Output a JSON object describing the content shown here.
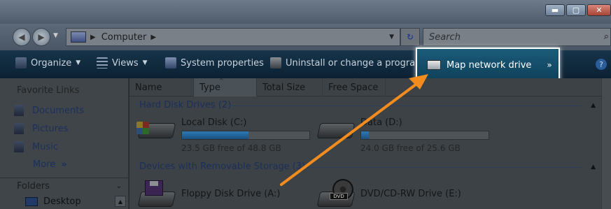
{
  "window": {
    "min_glyph": "▬",
    "max_glyph": "▢",
    "close_glyph": "✕"
  },
  "nav": {
    "back_glyph": "◀",
    "forward_glyph": "▶",
    "dropdown_glyph": "▼",
    "address_crumb": "Computer",
    "address_sep": "▶",
    "address_drop": "▼",
    "refresh_glyph": "↻",
    "search_placeholder": "Search",
    "search_icon_glyph": "⌕"
  },
  "commands": {
    "organize": "Organize",
    "views": "Views",
    "system_properties": "System properties",
    "uninstall": "Uninstall or change a program",
    "map_network_drive": "Map network drive",
    "more": "»",
    "dropdown_glyph": "▼",
    "help_glyph": "?"
  },
  "sidebar": {
    "favorite_links_header": "Favorite Links",
    "items": [
      {
        "label": "Documents",
        "icon": "documents-icon"
      },
      {
        "label": "Pictures",
        "icon": "pictures-icon"
      },
      {
        "label": "Music",
        "icon": "music-icon"
      }
    ],
    "more_label": "More",
    "more_glyph": "»",
    "folders_header": "Folders",
    "folders_chevron": "⌄",
    "desktop_label": "Desktop",
    "scroll_up_glyph": "▲"
  },
  "columns": {
    "name": "Name",
    "type": "Type",
    "total_size": "Total Size",
    "free_space": "Free Space",
    "sort_glyph": "^"
  },
  "groups": {
    "hard_disk": "Hard Disk Drives (2)",
    "removable": "Devices with Removable Storage (3)",
    "collapse_glyph": "▲"
  },
  "drives": {
    "local_c": {
      "name": "Local Disk (C:)",
      "free": "23.5 GB free of 48.8 GB",
      "used_fraction": 0.52
    },
    "data_d": {
      "name": "Data (D:)",
      "free": "24.0 GB free of 25.6 GB",
      "used_fraction": 0.06
    },
    "floppy_a": {
      "name": "Floppy Disk Drive (A:)"
    },
    "dvd_e": {
      "name": "DVD/CD-RW Drive (E:)",
      "label": "DVD"
    }
  },
  "colors": {
    "highlight_border": "#ffffff",
    "annotation_arrow": "#f28c1e",
    "progress_fill": "#2c7bb6"
  }
}
